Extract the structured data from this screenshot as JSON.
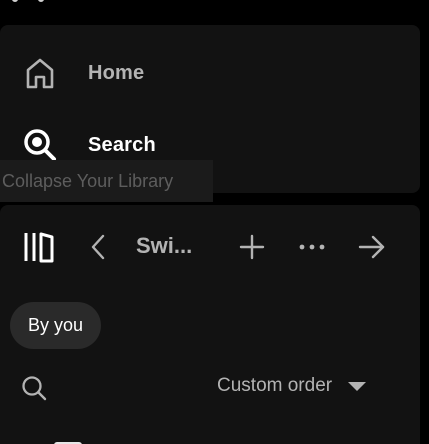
{
  "nav": {
    "home_label": "Home",
    "search_label": "Search"
  },
  "tooltip": {
    "text": "Collapse Your Library"
  },
  "library": {
    "title": "Swi...",
    "filter_chip": "By you",
    "sort_label": "Custom order"
  },
  "icons": {
    "home": "home-icon",
    "search": "search-icon",
    "library": "library-icon",
    "back": "chevron-left-icon",
    "add": "plus-icon",
    "more": "more-options-icon",
    "expand": "arrow-right-icon",
    "sort_caret": "caret-down-icon"
  },
  "colors": {
    "background": "#000000",
    "panel": "#121212",
    "text_active": "#ffffff",
    "text_muted": "#b3b3b3",
    "chip_bg": "#2a2a2a",
    "tooltip_bg": "#1b1b1b",
    "tooltip_text": "#5d5d5d"
  }
}
